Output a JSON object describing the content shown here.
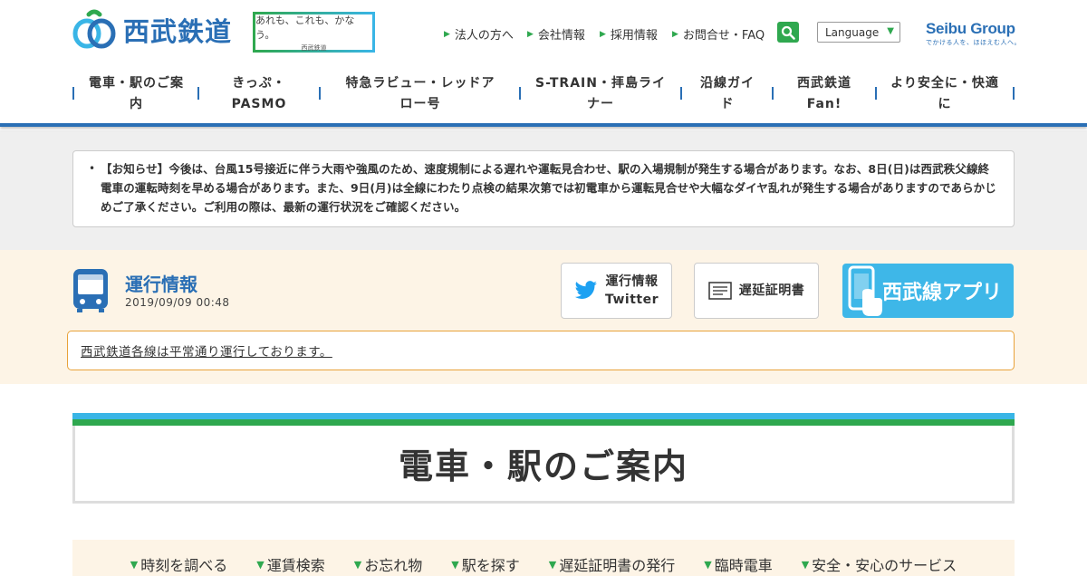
{
  "header": {
    "logo_text": "西武鉄道",
    "slogan_main": "あれも、これも、かなう。",
    "slogan_sub": "西武鉄道",
    "util_links": [
      "法人の方へ",
      "会社情報",
      "採用情報",
      "お問合せ・FAQ"
    ],
    "language_label": "Language",
    "group_logo_main": "Seibu Group",
    "group_logo_sub": "でかける人を、ほほえむ人へ。"
  },
  "global_nav": [
    {
      "line1": "電車・駅のご案",
      "line2": "内"
    },
    {
      "line1": "きっぷ・",
      "line2": "PASMO"
    },
    {
      "line1": "特急ラビュー・レッドア",
      "line2": "ロー号"
    },
    {
      "line1": "S-TRAIN・拝島ライ",
      "line2": "ナー"
    },
    {
      "line1": "沿線ガイ",
      "line2": "ド"
    },
    {
      "line1": "西武鉄道",
      "line2": "Fan!"
    },
    {
      "line1": "より安全に・快適",
      "line2": "に"
    }
  ],
  "notice": {
    "text": "【お知らせ】今後は、台風15号接近に伴う大雨や強風のため、速度規制による遅れや運転見合わせ、駅の入場規制が発生する場合があります。なお、8日(日)は西武秩父線終電車の運転時刻を早める場合があります。また、9日(月)は全線にわたり点検の結果次第では初電車から運転見合せや大幅なダイヤ乱れが発生する場合がありますのであらかじめご了承ください。ご利用の際は、最新の運行状況をご確認ください。"
  },
  "operation": {
    "title": "運行情報",
    "datetime": "2019/09/09 00:48",
    "twitter_line1": "運行情報",
    "twitter_line2": "Twitter",
    "delay_cert_label": "遅延証明書",
    "app_label": "西武線アプリ",
    "status_text": "西武鉄道各線は平常通り運行しております。"
  },
  "page_title": "電車・駅のご案内",
  "sub_nav": [
    "時刻を調べる",
    "運賃検索",
    "お忘れ物",
    "駅を探す",
    "遅延証明書の発行",
    "臨時電車",
    "安全・安心のサービス"
  ],
  "colors": {
    "brand_blue": "#2a6fb5",
    "accent_green": "#2fa84f",
    "light_blue": "#39b5e6",
    "status_border": "#e8a23a",
    "band_beige": "#fdf4e6"
  }
}
